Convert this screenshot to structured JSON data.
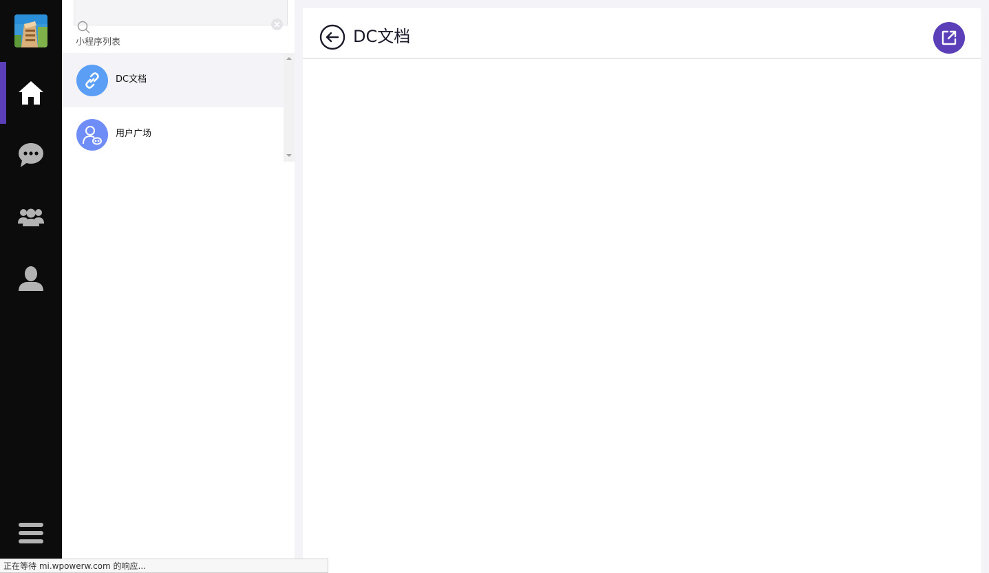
{
  "rail": {
    "items": [
      {
        "name": "home",
        "active": true
      },
      {
        "name": "messages",
        "active": false
      },
      {
        "name": "contacts",
        "active": false
      },
      {
        "name": "profile",
        "active": false
      }
    ],
    "accent": "#5b3fb8"
  },
  "panel": {
    "search": {
      "placeholder": "",
      "value": ""
    },
    "section_label": "小程序列表",
    "items": [
      {
        "label": "DC文档",
        "icon": "link-icon",
        "color": "#5a9ff5",
        "selected": true
      },
      {
        "label": "用户广场",
        "icon": "user-plaza-icon",
        "color": "#6f8df6",
        "selected": false
      }
    ]
  },
  "main": {
    "title": "DC文档"
  },
  "status": {
    "text": "正在等待 mi.wpowerw.com 的响应..."
  }
}
